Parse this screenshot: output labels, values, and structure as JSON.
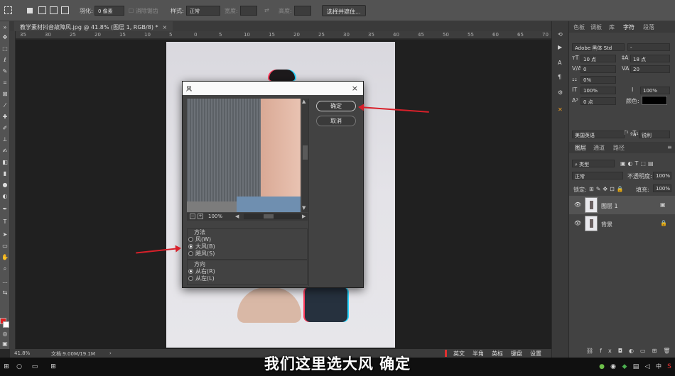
{
  "options_bar": {
    "feather_label": "羽化:",
    "feather_value": "0 像素",
    "antialias_label": "消除锯齿",
    "style_label": "样式:",
    "style_value": "正常",
    "width_label": "宽度:",
    "height_label": "高度:",
    "select_mask_button": "选择并遮住..."
  },
  "document": {
    "tab_title": "教学素材抖音故障风.jpg @ 41.8% (图层 1, RGB/8) *",
    "ruler_ticks": [
      "35",
      "30",
      "25",
      "20",
      "15",
      "10",
      "5",
      "0",
      "5",
      "10",
      "15",
      "20",
      "25",
      "30",
      "35",
      "40",
      "45",
      "50",
      "55",
      "60",
      "65",
      "70"
    ],
    "zoom_status": "41.8%",
    "doc_size": "文档:9.00M/19.1M"
  },
  "filter_dialog": {
    "title": "风",
    "ok_button": "确定",
    "cancel_button": "取消",
    "preview_zoom": "100%",
    "method_label": "方法",
    "method_options": [
      "风(W)",
      "大风(B)",
      "飓风(S)"
    ],
    "method_selected": 1,
    "direction_label": "方向",
    "direction_options": [
      "从右(R)",
      "从左(L)"
    ],
    "direction_selected": 0
  },
  "character_panel": {
    "tabs": [
      "色板",
      "调板",
      "库",
      "字符",
      "段落"
    ],
    "active_tab": "字符",
    "font_family": "Adobe 黑体 Std",
    "font_style": "-",
    "font_size": "10 点",
    "leading": "18 点",
    "kerning": "0",
    "tracking": "20",
    "tsume": "0%",
    "vertical_scale": "100%",
    "horizontal_scale": "100%",
    "baseline_shift": "0 点",
    "color_label": "颜色:",
    "language": "美国英语",
    "antialias": "锐利",
    "type_buttons": [
      "T",
      "T",
      "TT",
      "Tт",
      "T¹",
      "T₁",
      "T",
      "T"
    ]
  },
  "layers_panel": {
    "tabs": [
      "图层",
      "通道",
      "路径"
    ],
    "active_tab": "图层",
    "filter_kind": "类型",
    "blend_mode": "正常",
    "opacity_label": "不透明度:",
    "opacity_value": "100%",
    "lock_label": "锁定:",
    "fill_label": "填充:",
    "fill_value": "100%",
    "layers": [
      {
        "name": "图层 1",
        "selected": true
      },
      {
        "name": "背景",
        "selected": false
      }
    ]
  },
  "ime_bar": [
    "英文",
    "半角",
    "英标",
    "键盘",
    "设置"
  ],
  "tray": {
    "ime": "中"
  },
  "subtitle": "我们这里选大风  确定",
  "colors": {
    "foreground": "#e02020",
    "background": "#ffffff",
    "annotation_arrow": "#d8202a"
  }
}
